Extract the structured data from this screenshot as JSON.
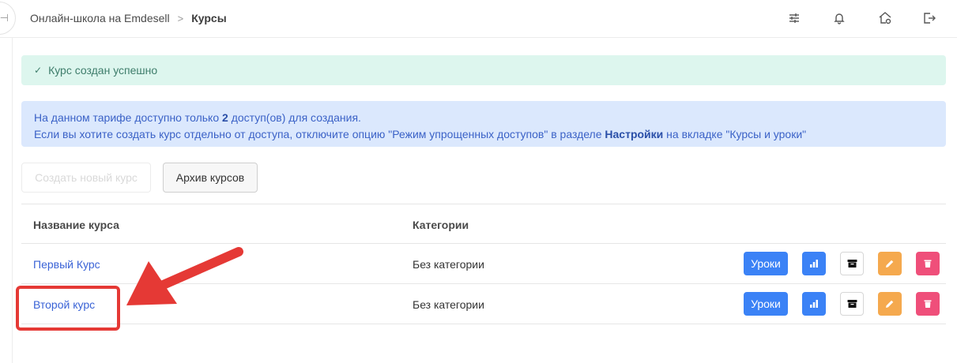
{
  "breadcrumb": {
    "root": "Онлайн-школа на Emdesell",
    "separator": ">",
    "current": "Курсы"
  },
  "header_icons": [
    "sliders-icon",
    "bell-icon",
    "home-settings-icon",
    "logout-icon"
  ],
  "alerts": {
    "success": "Курс создан успешно",
    "info_line1_pre": "На данном тарифе доступно только ",
    "info_line1_bold": "2",
    "info_line1_post": " доступ(ов) для создания.",
    "info_line2_pre": "Если вы хотите создать курс отдельно от доступа, отключите опцию \"Режим упрощенных доступов\" в разделе ",
    "info_line2_bold": "Настройки",
    "info_line2_post": " на вкладке \"Курсы и уроки\""
  },
  "buttons": {
    "create": "Создать новый курс",
    "archive": "Архив курсов"
  },
  "table": {
    "headers": {
      "name": "Название курса",
      "category": "Категории"
    },
    "rows": [
      {
        "name": "Первый Курс",
        "category": "Без категории",
        "lessons": "Уроки"
      },
      {
        "name": "Второй курс",
        "category": "Без категории",
        "lessons": "Уроки"
      }
    ]
  },
  "colors": {
    "primary": "#3b82f6",
    "warning": "#f5a94e",
    "danger": "#ef4f7a",
    "success_bg": "#ddf6ee",
    "info_bg": "#dbe8fd",
    "annotation": "#e53935"
  }
}
